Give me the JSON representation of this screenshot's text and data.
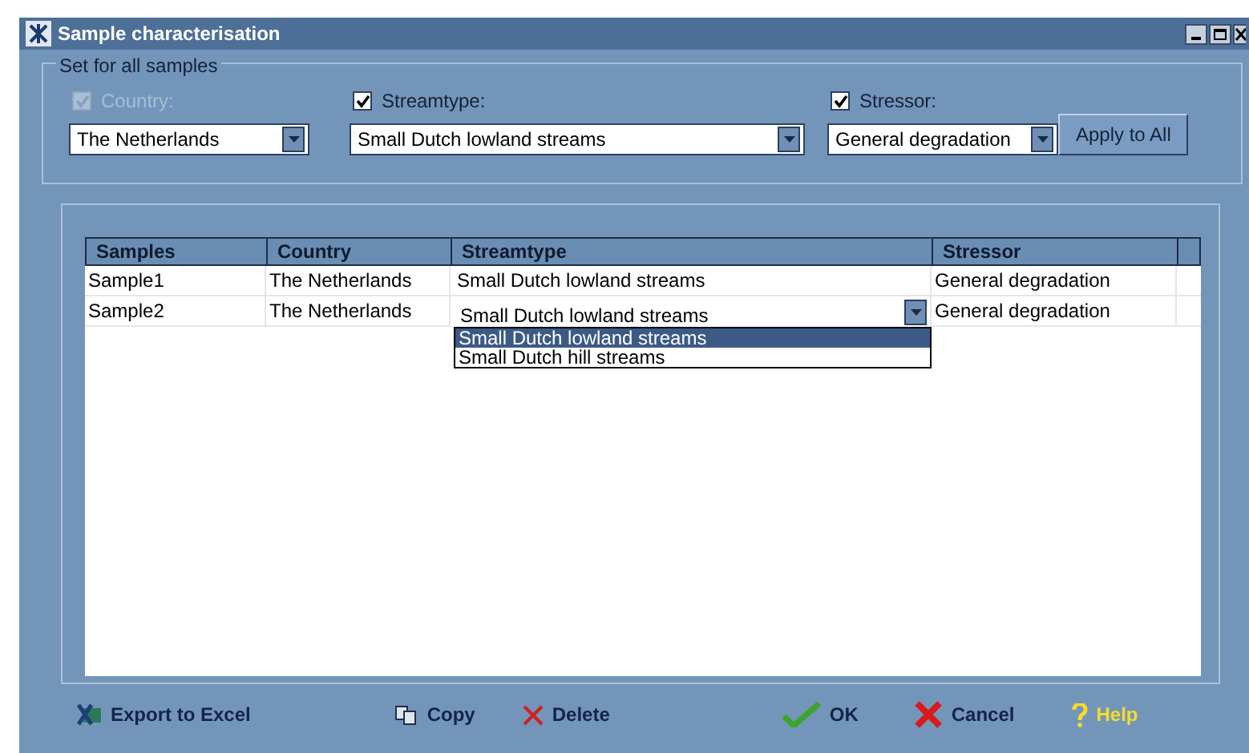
{
  "window": {
    "title": "Sample characterisation"
  },
  "group": {
    "title": "Set for all samples",
    "fields": [
      {
        "label": "Country:",
        "checked": true,
        "disabled": true,
        "value": "The Netherlands"
      },
      {
        "label": "Streamtype:",
        "checked": true,
        "disabled": false,
        "value": "Small Dutch lowland streams"
      },
      {
        "label": "Stressor:",
        "checked": true,
        "disabled": false,
        "value": "General degradation"
      }
    ],
    "apply_button": "Apply to All"
  },
  "table": {
    "columns": [
      "Samples",
      "Country",
      "Streamtype",
      "Stressor"
    ],
    "rows": [
      {
        "cells": [
          "Sample1",
          "The Netherlands",
          "Small Dutch lowland streams",
          "General degradation"
        ],
        "editing": false
      },
      {
        "cells": [
          "Sample2",
          "The Netherlands",
          "Small Dutch lowland streams",
          "General degradation"
        ],
        "editing": true
      }
    ],
    "dropdown_options": [
      {
        "label": "Small Dutch lowland streams",
        "selected": true
      },
      {
        "label": "Small Dutch hill streams",
        "selected": false
      }
    ]
  },
  "buttons": [
    {
      "kind": "excel",
      "label": "Export to Excel"
    },
    {
      "kind": "copy",
      "label": "Copy"
    },
    {
      "kind": "delete",
      "label": "Delete"
    },
    {
      "kind": "ok",
      "label": "OK"
    },
    {
      "kind": "cancel",
      "label": "Cancel"
    },
    {
      "kind": "help",
      "label": "Help"
    }
  ]
}
